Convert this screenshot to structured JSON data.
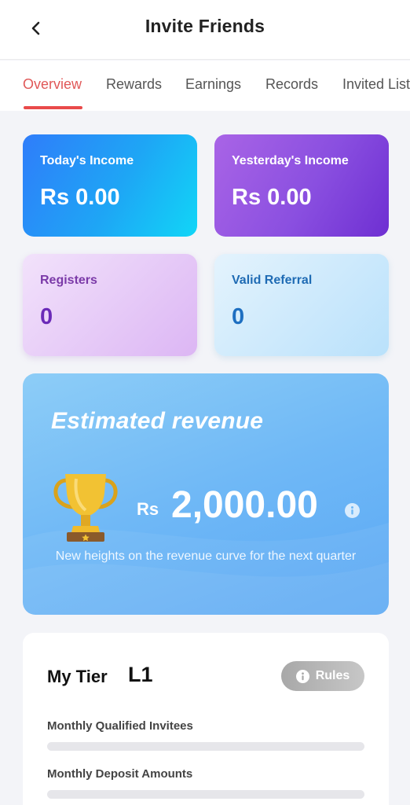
{
  "header": {
    "title": "Invite Friends"
  },
  "tabs": [
    {
      "label": "Overview",
      "active": true
    },
    {
      "label": "Rewards",
      "active": false
    },
    {
      "label": "Earnings",
      "active": false
    },
    {
      "label": "Records",
      "active": false
    },
    {
      "label": "Invited List",
      "active": false
    }
  ],
  "stats": {
    "today": {
      "label": "Today's Income",
      "value": "Rs 0.00"
    },
    "yesterday": {
      "label": "Yesterday's Income",
      "value": "Rs 0.00"
    },
    "registers": {
      "label": "Registers",
      "value": "0"
    },
    "valid_referral": {
      "label": "Valid Referral",
      "value": "0"
    }
  },
  "revenue": {
    "title": "Estimated revenue",
    "currency": "Rs",
    "value": "2,000.00",
    "description": "New heights on the revenue curve for the next quarter"
  },
  "tier": {
    "label": "My Tier",
    "level": "L1",
    "rules_label": "Rules",
    "metrics": [
      {
        "label": "Monthly Qualified Invitees",
        "progress": 0
      },
      {
        "label": "Monthly Deposit Amounts",
        "progress": 0
      }
    ]
  },
  "colors": {
    "accent": "#e94a4a",
    "today_card": "#1ea6f5",
    "yesterday_card": "#8a4fe0",
    "revenue_card": "#6fb8f6"
  },
  "icons": {
    "back": "chevron-left-icon",
    "info": "info-icon",
    "trophy": "trophy-icon"
  }
}
